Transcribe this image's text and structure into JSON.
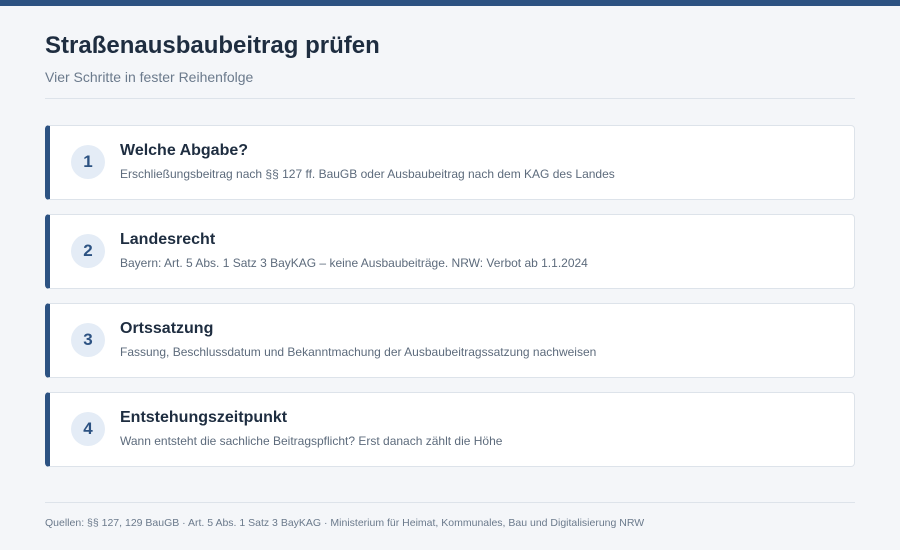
{
  "header": {
    "title": "Straßenausbaubeitrag prüfen",
    "subtitle": "Vier Schritte in fester Reihenfolge"
  },
  "steps": [
    {
      "number": "1",
      "title": "Welche Abgabe?",
      "description": "Erschließungsbeitrag nach §§ 127 ff. BauGB oder Ausbaubeitrag nach dem KAG des Landes"
    },
    {
      "number": "2",
      "title": "Landesrecht",
      "description": "Bayern: Art. 5 Abs. 1 Satz 3 BayKAG – keine Ausbaubeiträge. NRW: Verbot ab 1.1.2024"
    },
    {
      "number": "3",
      "title": "Ortssatzung",
      "description": "Fassung, Beschlussdatum und Bekanntmachung der Ausbaubeitragssatzung nachweisen"
    },
    {
      "number": "4",
      "title": "Entstehungszeitpunkt",
      "description": "Wann entsteht die sachliche Beitragspflicht? Erst danach zählt die Höhe"
    }
  ],
  "footer": {
    "sources": "Quellen: §§ 127, 129 BauGB · Art. 5 Abs. 1 Satz 3 BayKAG · Ministerium für Heimat, Kommunales, Bau und Digitalisierung NRW"
  },
  "colors": {
    "accent": "#2c5282",
    "background": "#f4f6f9",
    "card": "#ffffff",
    "badge_bg": "#e4ecf6"
  }
}
